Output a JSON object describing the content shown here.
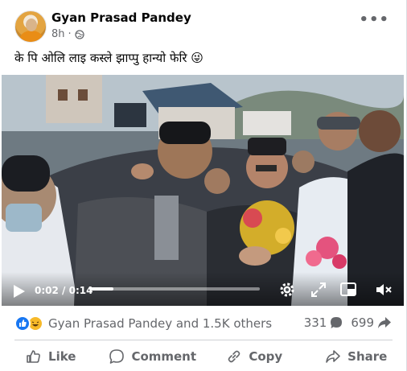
{
  "post": {
    "author": "Gyan Prasad Pandey",
    "time": "8h",
    "dot": "·",
    "caption": "के पि ओलि लाइ कस्ले झाप्पु हान्यो फेरि 😜",
    "privacy_icon": "globe-icon",
    "more_icon": "more-options-icon",
    "more_glyph": "•••"
  },
  "video": {
    "current_time": "0:02",
    "separator": "/",
    "duration": "0:14",
    "progress_fraction": 0.14,
    "controls": [
      "play-icon",
      "settings-gear-icon",
      "fullscreen-arrows-icon",
      "pip-icon",
      "mute-icon"
    ]
  },
  "engagement": {
    "reactions_text": "Gyan Prasad Pandey and 1.5K others",
    "reaction_icons": [
      "like-icon",
      "haha-icon"
    ],
    "comments_count": "331",
    "shares_count": "699"
  },
  "actions": {
    "like": "Like",
    "comment": "Comment",
    "copy": "Copy",
    "share": "Share"
  },
  "colors": {
    "brand_blue": "#1877f2",
    "secondary_text": "#65676b",
    "haha_yellow": "#f7b928"
  }
}
